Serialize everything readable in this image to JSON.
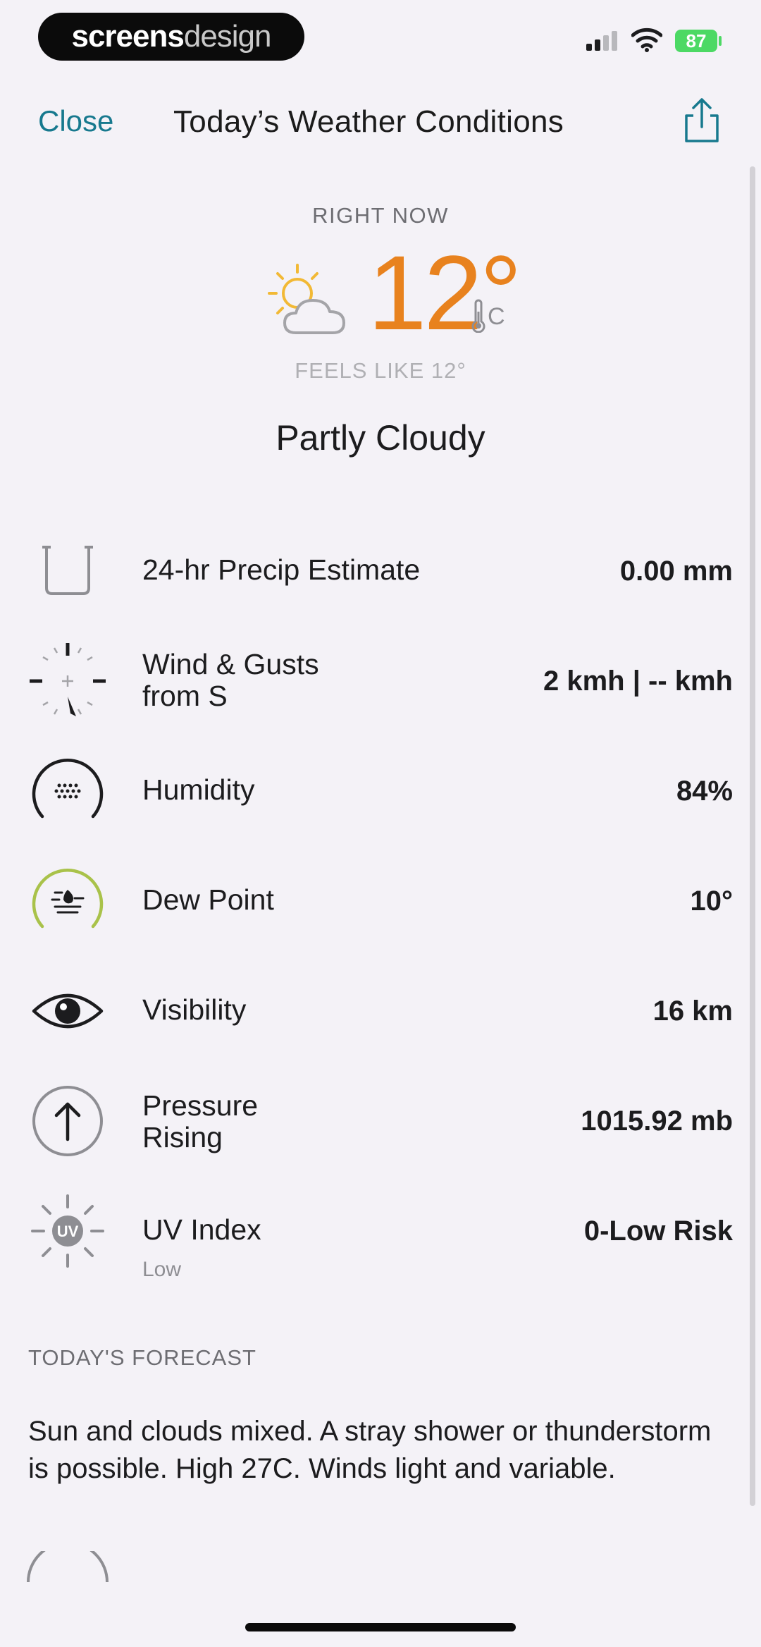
{
  "status_bar": {
    "brand_part1": "screens",
    "brand_part2": "design",
    "battery": "87"
  },
  "nav": {
    "close_label": "Close",
    "title": "Today’s Weather Conditions",
    "share_icon": "share-icon"
  },
  "current": {
    "label": "RIGHT NOW",
    "temperature": "12°",
    "unit": "C",
    "feels_like": "FEELS LIKE 12°",
    "condition": "Partly Cloudy",
    "condition_icon": "partly-cloudy-icon"
  },
  "rows": [
    {
      "label": "24-hr Precip Estimate",
      "label2": "",
      "sub": "",
      "value": "0.00 mm",
      "icon": "precip-gauge-icon"
    },
    {
      "label": "Wind & Gusts",
      "label2": "from S",
      "sub": "",
      "value": "2 kmh | -- kmh",
      "icon": "wind-compass-icon"
    },
    {
      "label": "Humidity",
      "label2": "",
      "sub": "",
      "value": "84%",
      "icon": "humidity-icon"
    },
    {
      "label": "Dew Point",
      "label2": "",
      "sub": "",
      "value": "10°",
      "icon": "dew-point-icon"
    },
    {
      "label": "Visibility",
      "label2": "",
      "sub": "",
      "value": "16 km",
      "icon": "eye-icon"
    },
    {
      "label": "Pressure",
      "label2": "Rising",
      "sub": "",
      "value": "1015.92 mb",
      "icon": "pressure-arrow-icon"
    },
    {
      "label": "UV Index",
      "label2": "",
      "sub": "Low",
      "value": "0-Low Risk",
      "icon": "uv-icon",
      "uv_badge": "UV"
    }
  ],
  "forecast": {
    "heading": "TODAY'S FORECAST",
    "text": "Sun and clouds mixed. A stray shower or thunderstorm is possible. High 27C. Winds light and variable."
  },
  "colors": {
    "accent": "#17798e",
    "temperature": "#e8821e",
    "dew_ring": "#a9c24a",
    "background": "#f4f2f7"
  }
}
